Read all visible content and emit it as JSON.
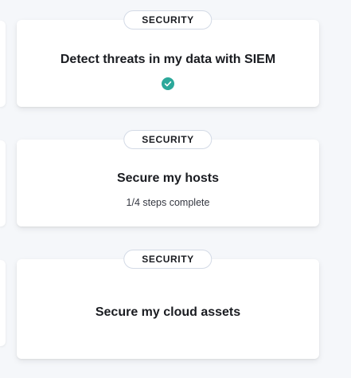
{
  "cards": [
    {
      "badge": "SECURITY",
      "title": "Detect threats in my data with SIEM",
      "status_icon": "check-circle-icon",
      "accent": "#2ba89a"
    },
    {
      "badge": "SECURITY",
      "title": "Secure my hosts",
      "progress_text": "1/4 steps complete"
    },
    {
      "badge": "SECURITY",
      "title": "Secure my cloud assets"
    }
  ]
}
